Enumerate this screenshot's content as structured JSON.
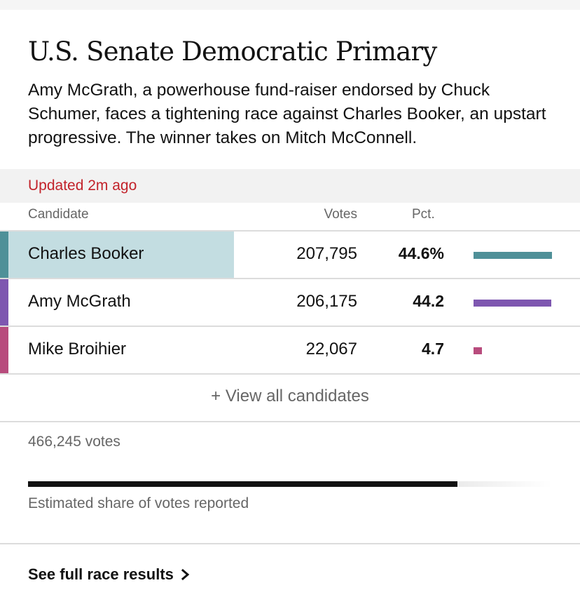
{
  "race": {
    "title": "U.S. Senate Democratic Primary",
    "description": "Amy McGrath, a powerhouse fund-raiser endorsed by Chuck Schumer, faces a tightening race against Charles Booker, an upstart progressive. The winner takes on Mitch McConnell."
  },
  "status": {
    "updated": "Updated 2m ago"
  },
  "table": {
    "headers": {
      "candidate": "Candidate",
      "votes": "Votes",
      "pct": "Pct."
    },
    "rows": [
      {
        "name": "Charles Booker",
        "votes": "207,795",
        "pct": "44.6%",
        "pct_value": 44.6,
        "color": "#4f9098",
        "leader": true
      },
      {
        "name": "Amy McGrath",
        "votes": "206,175",
        "pct": "44.2",
        "pct_value": 44.2,
        "color": "#7e57b0",
        "leader": false
      },
      {
        "name": "Mike Broihier",
        "votes": "22,067",
        "pct": "4.7",
        "pct_value": 4.7,
        "color": "#b84c7d",
        "leader": false
      }
    ],
    "view_all": "+ View all candidates"
  },
  "totals": {
    "votes": "466,245 votes",
    "reported_share": 0.82,
    "reported_label": "Estimated share of votes reported"
  },
  "footer": {
    "link_label": "See full race results",
    "link_icon": "chevron-right-icon"
  },
  "colors": {
    "updated_text": "#c2222a",
    "leader_highlight": "#c3dde1"
  }
}
